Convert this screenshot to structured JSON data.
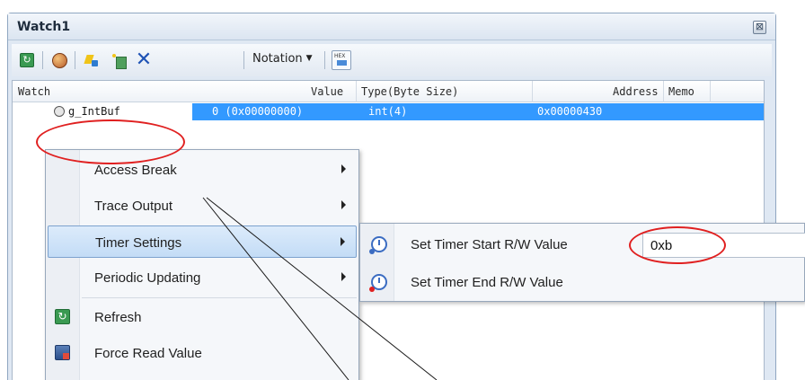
{
  "window": {
    "title": "Watch1",
    "close_label": "⊠"
  },
  "toolbar": {
    "icons": [
      "refresh-icon",
      "palette-icon",
      "add-watch-icon",
      "add-data-icon",
      "delete-icon",
      "hex-display-icon"
    ],
    "notation_label": "Notation"
  },
  "grid": {
    "headers": {
      "watch": "Watch",
      "value": "Value",
      "type": "Type(Byte Size)",
      "address": "Address",
      "memo": "Memo"
    },
    "rows": [
      {
        "name": "g_IntBuf",
        "value": "0 (0x00000000)",
        "type": "int(4)",
        "address": "0x00000430",
        "memo": ""
      }
    ]
  },
  "context_menu": {
    "items": [
      {
        "label": "Access Break",
        "has_submenu": true
      },
      {
        "label": "Trace Output",
        "has_submenu": true
      },
      {
        "label": "Timer Settings",
        "has_submenu": true,
        "highlighted": true
      },
      {
        "label": "Periodic Updating",
        "has_submenu": true
      },
      {
        "label": "Refresh",
        "icon": "refresh-icon"
      },
      {
        "label": "Force Read Value",
        "icon": "force-read-icon"
      }
    ]
  },
  "submenu": {
    "items": [
      {
        "label": "Set Timer Start R/W Value",
        "value": "0xb"
      },
      {
        "label": "Set Timer End R/W Value"
      }
    ]
  },
  "colors": {
    "selection": "#3399ff",
    "annotation": "#e02020",
    "menu_hover": "#c3dcf6"
  }
}
